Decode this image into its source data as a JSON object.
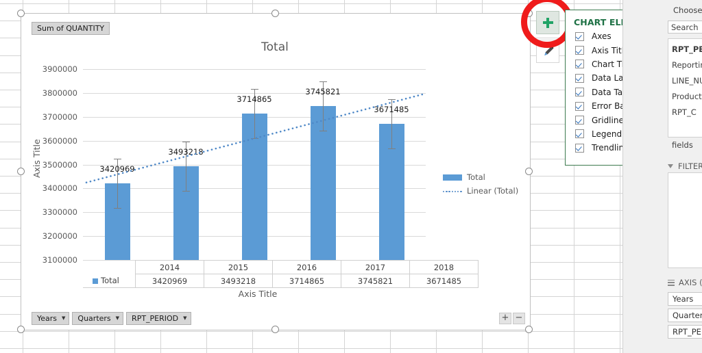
{
  "chart_data": {
    "type": "bar",
    "title": "Total",
    "xlabel": "Axis Title",
    "ylabel": "Axis Title",
    "categories": [
      "2014",
      "2015",
      "2016",
      "2017",
      "2018"
    ],
    "values": [
      3420969,
      3493218,
      3714865,
      3745821,
      3671485
    ],
    "data_labels": [
      "3420969",
      "3493218",
      "3714865",
      "3745821",
      "3671485"
    ],
    "ylim": [
      3100000,
      3900000
    ],
    "ytick_labels": [
      "3900000",
      "3800000",
      "3700000",
      "3600000",
      "3500000",
      "3400000",
      "3300000",
      "3200000",
      "3100000"
    ],
    "ytick_values": [
      3900000,
      3800000,
      3700000,
      3600000,
      3500000,
      3400000,
      3300000,
      3200000,
      3100000
    ],
    "grid": true,
    "legend_position": "right",
    "series": [
      {
        "name": "Total",
        "values": [
          3420969,
          3493218,
          3714865,
          3745821,
          3671485
        ],
        "color": "#5b9bd5"
      },
      {
        "name": "Linear (Total)",
        "type": "trendline",
        "color": "#4e88c7",
        "style": "dotted"
      }
    ],
    "error_bars": {
      "visible": true,
      "color": "#7f7f7f"
    },
    "data_table": {
      "row_label": "Total",
      "columns": [
        "2014",
        "2015",
        "2016",
        "2017",
        "2018"
      ],
      "values": [
        "3420969",
        "3493218",
        "3714865",
        "3745821",
        "3671485"
      ]
    },
    "legend": [
      {
        "label": "Total",
        "marker": "bar",
        "color": "#5b9bd5"
      },
      {
        "label": "Linear (Total)",
        "marker": "dotted-line",
        "color": "#4e88c7"
      }
    ]
  },
  "chart": {
    "value_field_button": "Sum of QUANTITY",
    "field_buttons": [
      {
        "label": "Years",
        "caret": "▼"
      },
      {
        "label": "Quarters",
        "caret": "▼"
      },
      {
        "label": "RPT_PERIOD",
        "caret": "▼"
      }
    ],
    "expand_button": "+",
    "collapse_button": "−"
  },
  "side_buttons": {
    "chart_elements": {
      "icon": "plus-icon",
      "color": "#21a366"
    },
    "chart_styles": {
      "icon": "paintbrush-icon"
    }
  },
  "chart_elements_panel": {
    "title": "CHART ELEMENTS",
    "accent": "#1e7145",
    "items": [
      {
        "label": "Axes",
        "checked": true
      },
      {
        "label": "Axis Titles",
        "checked": true
      },
      {
        "label": "Chart Title",
        "checked": true
      },
      {
        "label": "Data Labels",
        "checked": true
      },
      {
        "label": "Data Table",
        "checked": true
      },
      {
        "label": "Error Bars",
        "checked": true
      },
      {
        "label": "Gridlines",
        "checked": true
      },
      {
        "label": "Legend",
        "checked": true
      },
      {
        "label": "Trendline",
        "checked": true
      }
    ]
  },
  "annotation": {
    "shape": "circle",
    "color": "#ef1b1b"
  },
  "pivot_pane": {
    "choose_fields_label": "Choose fields",
    "search_placeholder": "Search",
    "field_items": [
      {
        "label": "RPT_PERIOD",
        "bold": true
      },
      {
        "label": "Reporting",
        "bold": false
      },
      {
        "label": "LINE_NUM",
        "bold": false
      },
      {
        "label": "Product",
        "bold": false
      },
      {
        "label": "RPT_C",
        "bold": false
      }
    ],
    "more_fields_label": "fields",
    "filters_header": "FILTERS",
    "axis_header": "AXIS (C",
    "axis_items": [
      "Years",
      "Quarters",
      "RPT_PERIOD"
    ]
  }
}
